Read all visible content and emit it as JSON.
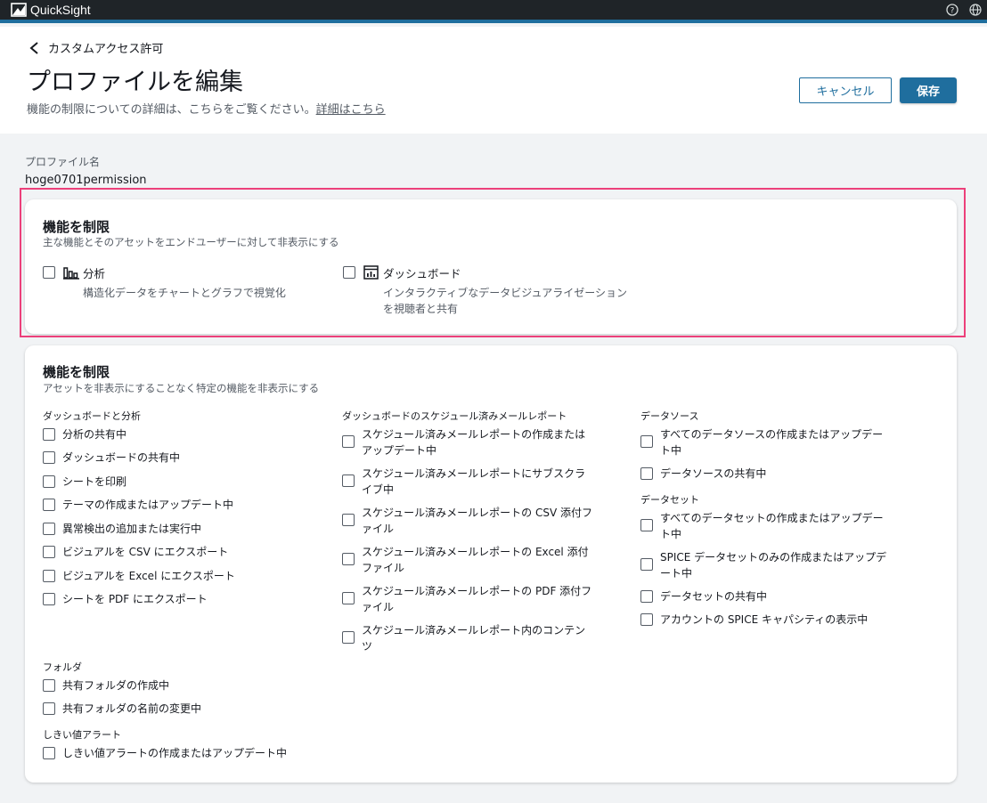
{
  "app": {
    "name": "QuickSight"
  },
  "header": {
    "back_label": "カスタムアクセス許可",
    "title": "プロファイルを編集",
    "subtitle": "機能の制限についての詳細は、こちらをご覧ください。",
    "subtitle_link": "詳細はこちら",
    "cancel_label": "キャンセル",
    "save_label": "保存"
  },
  "profile": {
    "label": "プロファイル名",
    "value": "hoge0701permission"
  },
  "restrict_assets": {
    "title": "機能を制限",
    "subtitle": "主な機能とそのアセットをエンドユーザーに対して非表示にする",
    "items": [
      {
        "icon": "bar-chart-icon",
        "name": "分析",
        "desc": "構造化データをチャートとグラフで視覚化"
      },
      {
        "icon": "dashboard-icon",
        "name": "ダッシュボード",
        "desc": "インタラクティブなデータビジュアライゼーションを視聴者と共有"
      }
    ]
  },
  "restrict_features": {
    "title": "機能を制限",
    "subtitle": "アセットを非表示にすることなく特定の機能を非表示にする",
    "groups": {
      "dashboard_analysis": {
        "label": "ダッシュボードと分析",
        "items": [
          "分析の共有中",
          "ダッシュボードの共有中",
          "シートを印刷",
          "テーマの作成またはアップデート中",
          "異常検出の追加または実行中",
          "ビジュアルを CSV にエクスポート",
          "ビジュアルを Excel にエクスポート",
          "シートを PDF にエクスポート"
        ]
      },
      "scheduled_reports": {
        "label": "ダッシュボードのスケジュール済みメールレポート",
        "items": [
          "スケジュール済みメールレポートの作成またはアップデート中",
          "スケジュール済みメールレポートにサブスクライブ中",
          "スケジュール済みメールレポートの CSV 添付ファイル",
          "スケジュール済みメールレポートの Excel 添付ファイル",
          "スケジュール済みメールレポートの PDF 添付ファイル",
          "スケジュール済みメールレポート内のコンテンツ"
        ]
      },
      "datasource": {
        "label": "データソース",
        "items": [
          "すべてのデータソースの作成またはアップデート中",
          "データソースの共有中"
        ]
      },
      "dataset": {
        "label": "データセット",
        "items": [
          "すべてのデータセットの作成またはアップデート中",
          "SPICE データセットのみの作成またはアップデート中",
          "データセットの共有中",
          "アカウントの SPICE キャパシティの表示中"
        ]
      },
      "folder": {
        "label": "フォルダ",
        "items": [
          "共有フォルダの作成中",
          "共有フォルダの名前の変更中"
        ]
      },
      "threshold": {
        "label": "しきい値アラート",
        "items": [
          "しきい値アラートの作成またはアップデート中"
        ]
      }
    }
  },
  "colors": {
    "accent": "#1f6e9e",
    "highlight": "#ec407a",
    "topbar": "#1f2428"
  }
}
